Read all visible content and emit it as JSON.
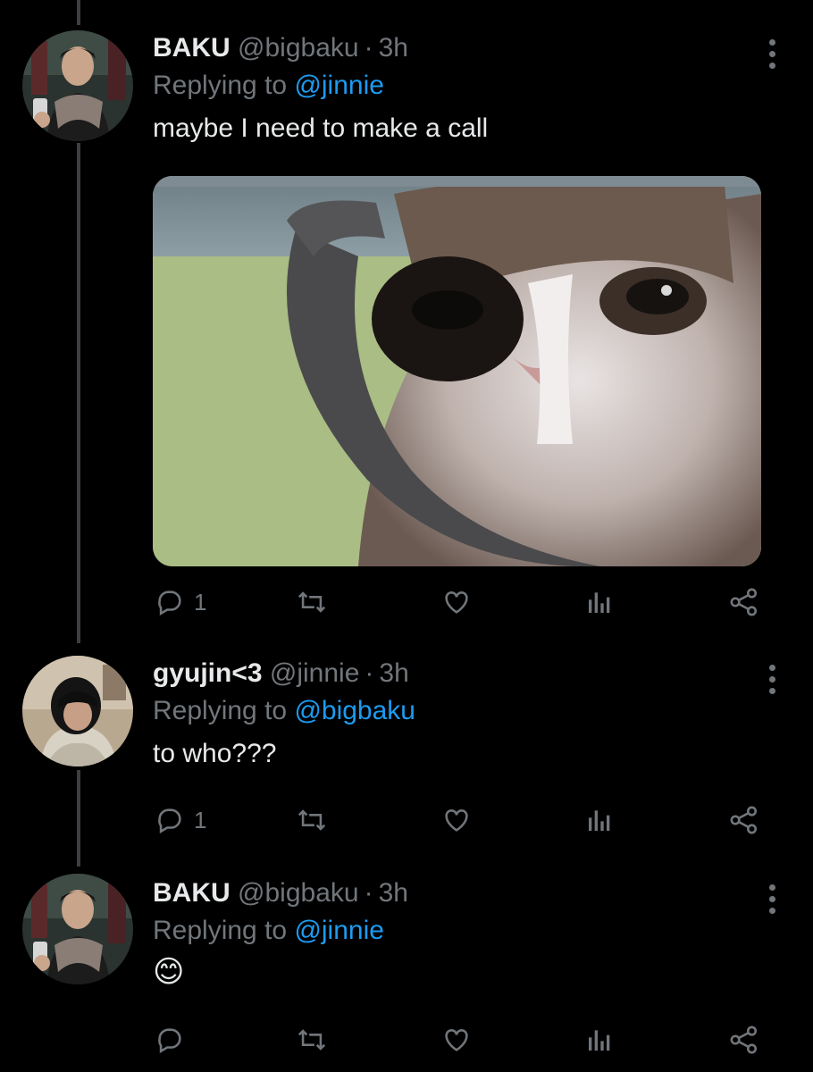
{
  "tweets": [
    {
      "name": "BAKU",
      "handle": "@bigbaku",
      "time": "3h",
      "replying_prefix": "Replying to",
      "replying_to": "@jinnie",
      "text": "maybe I need to make a call",
      "reply_count": "1",
      "has_media": true
    },
    {
      "name": "gyujin<3",
      "handle": "@jinnie",
      "time": "3h",
      "replying_prefix": "Replying to",
      "replying_to": "@bigbaku",
      "text": "to who???",
      "reply_count": "1"
    },
    {
      "name": "BAKU",
      "handle": "@bigbaku",
      "time": "3h",
      "replying_prefix": "Replying to",
      "replying_to": "@jinnie",
      "text": "😊",
      "reply_count": ""
    }
  ],
  "theme": {
    "background": "#000000",
    "text": "#e7e9ea",
    "muted": "#71767b",
    "link": "#1d9bf0",
    "thread_line": "#3b3f44"
  },
  "icons": [
    "reply-icon",
    "retweet-icon",
    "like-icon",
    "analytics-icon",
    "share-icon",
    "more-options-icon"
  ]
}
